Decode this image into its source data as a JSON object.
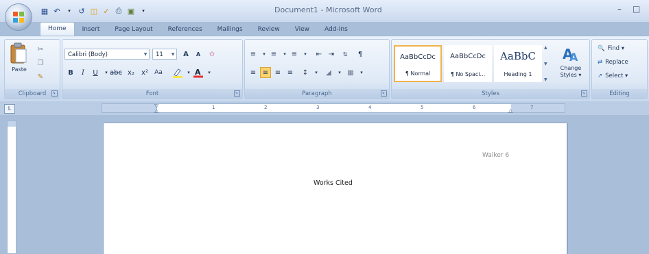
{
  "app": {
    "title": "Document1 - Microsoft Word"
  },
  "tabs": [
    "Home",
    "Insert",
    "Page Layout",
    "References",
    "Mailings",
    "Review",
    "View",
    "Add-Ins"
  ],
  "ribbon": {
    "clipboard": {
      "label": "Clipboard",
      "paste": "Paste"
    },
    "font": {
      "label": "Font",
      "name": "Calibri (Body)",
      "size": "11",
      "grow": "A",
      "shrink": "A",
      "bold": "B",
      "italic": "I",
      "underline": "U",
      "change_case": "Aa"
    },
    "paragraph": {
      "label": "Paragraph"
    },
    "styles": {
      "label": "Styles",
      "items": [
        {
          "sample": "AaBbCcDc",
          "name": "¶ Normal"
        },
        {
          "sample": "AaBbCcDc",
          "name": "¶ No Spaci..."
        },
        {
          "sample": "AaBbC",
          "name": "Heading 1"
        }
      ],
      "change_styles": "Change Styles ▾"
    },
    "editing": {
      "label": "Editing",
      "find": "Find ▾",
      "replace": "Replace",
      "select": "Select ▾"
    }
  },
  "ruler": {
    "numbers": [
      "1",
      "2",
      "3",
      "4",
      "5",
      "6",
      "7"
    ]
  },
  "document": {
    "header": "Walker 6",
    "body": "Works Cited"
  },
  "colors": {
    "highlight": "#f6e84a",
    "font_color": "#e53030",
    "selected": "#ffd46e"
  },
  "icons": [
    "office-button-icon",
    "save-icon",
    "undo-icon",
    "redo-icon",
    "paste-icon",
    "cut-icon",
    "copy-icon",
    "format-painter-icon",
    "bullets-icon",
    "numbering-icon",
    "align-left-icon",
    "align-center-icon",
    "find-icon",
    "replace-icon",
    "select-icon"
  ]
}
